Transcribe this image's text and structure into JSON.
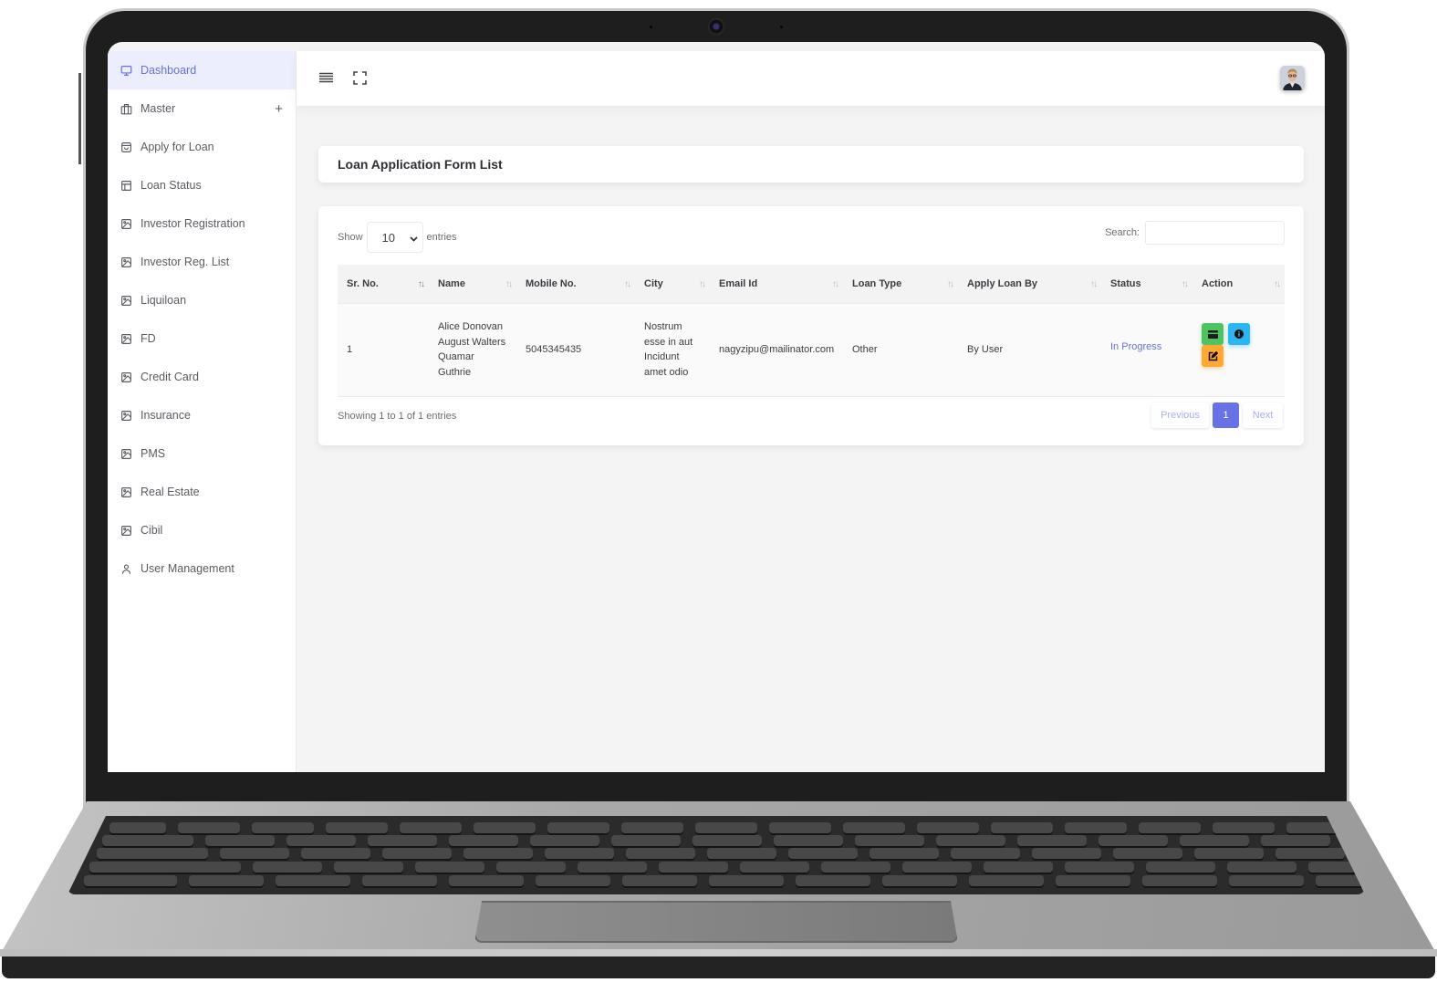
{
  "sidebar": {
    "items": [
      {
        "label": "Dashboard",
        "icon": "monitor-icon",
        "active": true
      },
      {
        "label": "Master",
        "icon": "briefcase-icon",
        "expandable": "+"
      },
      {
        "label": "Apply for Loan",
        "icon": "shopping-bag-icon"
      },
      {
        "label": "Loan Status",
        "icon": "layout-icon"
      },
      {
        "label": "Investor Registration",
        "icon": "image-icon"
      },
      {
        "label": "Investor Reg. List",
        "icon": "image-icon"
      },
      {
        "label": "Liquiloan",
        "icon": "image-icon"
      },
      {
        "label": "FD",
        "icon": "image-icon"
      },
      {
        "label": "Credit Card",
        "icon": "image-icon"
      },
      {
        "label": "Insurance",
        "icon": "image-icon"
      },
      {
        "label": "PMS",
        "icon": "image-icon"
      },
      {
        "label": "Real Estate",
        "icon": "image-icon"
      },
      {
        "label": "Cibil",
        "icon": "image-icon"
      },
      {
        "label": "User Management",
        "icon": "user-icon"
      }
    ]
  },
  "topbar": {
    "menu_icon": "hamburger-menu-icon",
    "fullscreen_icon": "fullscreen-icon",
    "avatar": "user-avatar"
  },
  "page": {
    "title": "Loan Application Form List"
  },
  "table": {
    "show_label": "Show",
    "entries_label": "entries",
    "page_length": "10",
    "search_label": "Search:",
    "search_value": "",
    "columns": [
      "Sr. No.",
      "Name",
      "Mobile No.",
      "City",
      "Email Id",
      "Loan Type",
      "Apply Loan By",
      "Status",
      "Action"
    ],
    "sort_glyph": "↑↓",
    "rows": [
      {
        "sr_no": "1",
        "name": "Alice Donovan August Walters Quamar Guthrie",
        "mobile": "5045345435",
        "city": "Nostrum esse in aut Incidunt amet odio",
        "email": "nagyzipu@mailinator.com",
        "loan_type": "Other",
        "apply_by": "By User",
        "status": "In Progress",
        "actions": [
          "card-icon",
          "info-icon",
          "edit-icon"
        ]
      }
    ],
    "info": "Showing 1 to 1 of 1 entries",
    "pagination": {
      "previous": "Previous",
      "current": "1",
      "next": "Next"
    }
  },
  "colors": {
    "accent": "#6872dd",
    "active_bg": "#eceefd",
    "action_green": "#4fc360",
    "action_blue": "#2db5f0",
    "action_orange": "#ffa834"
  }
}
